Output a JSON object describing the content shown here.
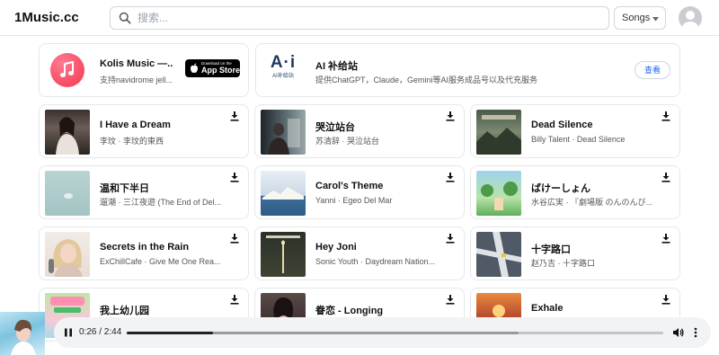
{
  "header": {
    "logo": "1Music.cc",
    "search_placeholder": "搜索...",
    "filter": "Songs"
  },
  "promos": [
    {
      "title": "Kolis Music —...",
      "subtitle": "支持navidrome jell...",
      "badge_small": "Download on the",
      "badge_big": "App Store"
    },
    {
      "logo_big": "A·i",
      "logo_small": "AI补给站",
      "title": "AI 补给站",
      "subtitle": "提供ChatGPT，Claude，Gemini等AI服务成品号以及代充服务",
      "button": "查看"
    }
  ],
  "songs": [
    {
      "title": "I Have a Dream",
      "subtitle": "李玟 · 李玟的東西"
    },
    {
      "title": "哭泣站台",
      "subtitle": "苏清辞 · 哭泣站台"
    },
    {
      "title": "Dead Silence",
      "subtitle": "Billy Talent · Dead Silence"
    },
    {
      "title": "温和下半日",
      "subtitle": "遛潮 · 三江夜遊 (The End of Del..."
    },
    {
      "title": "Carol's Theme",
      "subtitle": "Yanni · Egeo Del Mar"
    },
    {
      "title": "ばけーしょん",
      "subtitle": "水谷広実 · 『劇場版 のんのんび..."
    },
    {
      "title": "Secrets in the Rain",
      "subtitle": "ExChillCafe · Give Me One Rea..."
    },
    {
      "title": "Hey Joni",
      "subtitle": "Sonic Youth · Daydream Nation..."
    },
    {
      "title": "十字路口",
      "subtitle": "赵乃吉 · 十字路口"
    },
    {
      "title": "我上幼儿园",
      "subtitle": ""
    },
    {
      "title": "眷恋 - Longing",
      "subtitle": ""
    },
    {
      "title": "Exhale",
      "subtitle": ""
    }
  ],
  "player": {
    "time": "0:26 / 2:44",
    "progress": 0.16,
    "buffered": 0.73
  },
  "colors": {
    "accent": "#f2364f",
    "link": "#2563eb"
  },
  "icons": [
    "search-icon",
    "chevron-down-icon",
    "user-avatar-icon",
    "music-note-icon",
    "apple-icon",
    "download-icon",
    "pause-icon",
    "volume-icon",
    "more-vertical-icon"
  ]
}
